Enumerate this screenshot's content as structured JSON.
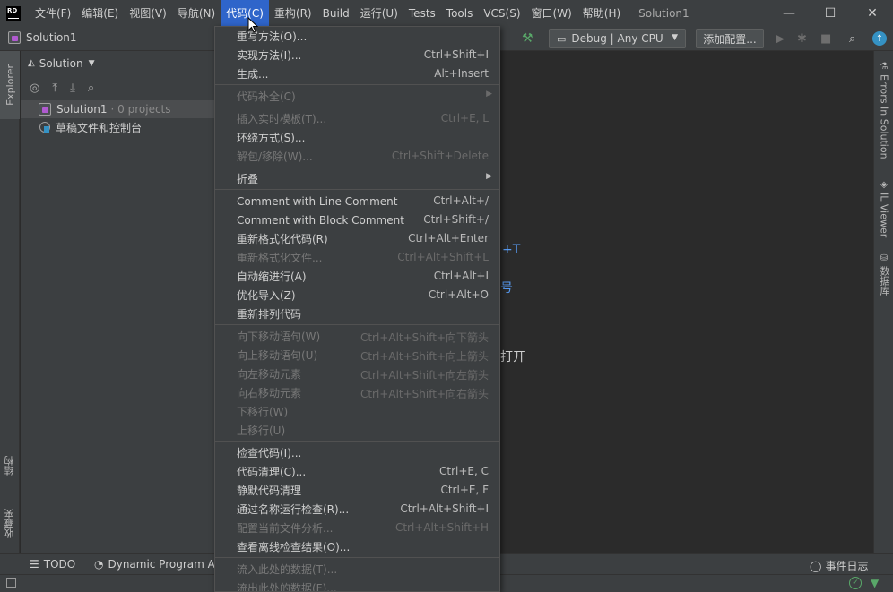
{
  "menubar": {
    "logo": "RD",
    "items": [
      "文件(F)",
      "编辑(E)",
      "视图(V)",
      "导航(N)",
      "代码(C)",
      "重构(R)",
      "Build",
      "运行(U)",
      "Tests",
      "Tools",
      "VCS(S)",
      "窗口(W)",
      "帮助(H)"
    ],
    "active_index": 4,
    "window_title": "Solution1"
  },
  "window_controls": {
    "minimize": "—",
    "maximize": "☐",
    "close": "✕"
  },
  "toolbar": {
    "breadcrumb": "Solution1",
    "config": "Debug | Any CPU",
    "add_config": "添加配置..."
  },
  "left_strip": {
    "explorer_tab": "Explorer",
    "structure_tab": "结构",
    "favorites_tab": "收藏夹"
  },
  "explorer": {
    "header": "Solution",
    "tree": [
      {
        "label": "Solution1",
        "meta": "· 0 projects"
      },
      {
        "label": "草稿文件和控制台",
        "meta": ""
      }
    ]
  },
  "editor_hints": [
    "+T",
    "号",
    "打开"
  ],
  "right_strip": {
    "tabs": [
      "Errors In Solution",
      "IL Viewer",
      "数据库"
    ]
  },
  "bottom_tools": {
    "todo": "TODO",
    "dpa": "Dynamic Program Ana",
    "event_log": "事件日志"
  },
  "code_menu": {
    "groups": [
      [
        {
          "label": "重写方法(O)...",
          "shortcut": "",
          "disabled": false
        },
        {
          "label": "实现方法(I)...",
          "shortcut": "Ctrl+Shift+I",
          "disabled": false
        },
        {
          "label": "生成...",
          "shortcut": "Alt+Insert",
          "disabled": false
        }
      ],
      [
        {
          "label": "代码补全(C)",
          "shortcut": "",
          "disabled": true,
          "submenu": true
        }
      ],
      [
        {
          "label": "插入实时模板(T)...",
          "shortcut": "Ctrl+E, L",
          "disabled": true
        },
        {
          "label": "环绕方式(S)...",
          "shortcut": "",
          "disabled": false
        },
        {
          "label": "解包/移除(W)...",
          "shortcut": "Ctrl+Shift+Delete",
          "disabled": true
        }
      ],
      [
        {
          "label": "折叠",
          "shortcut": "",
          "disabled": false,
          "submenu": true
        }
      ],
      [
        {
          "label": "Comment with Line Comment",
          "shortcut": "Ctrl+Alt+/",
          "disabled": false
        },
        {
          "label": "Comment with Block Comment",
          "shortcut": "Ctrl+Shift+/",
          "disabled": false
        },
        {
          "label": "重新格式化代码(R)",
          "shortcut": "Ctrl+Alt+Enter",
          "disabled": false
        },
        {
          "label": "重新格式化文件...",
          "shortcut": "Ctrl+Alt+Shift+L",
          "disabled": true
        },
        {
          "label": "自动缩进行(A)",
          "shortcut": "Ctrl+Alt+I",
          "disabled": false
        },
        {
          "label": "优化导入(Z)",
          "shortcut": "Ctrl+Alt+O",
          "disabled": false
        },
        {
          "label": "重新排列代码",
          "shortcut": "",
          "disabled": false
        }
      ],
      [
        {
          "label": "向下移动语句(W)",
          "shortcut": "Ctrl+Alt+Shift+向下箭头",
          "disabled": true
        },
        {
          "label": "向上移动语句(U)",
          "shortcut": "Ctrl+Alt+Shift+向上箭头",
          "disabled": true
        },
        {
          "label": "向左移动元素",
          "shortcut": "Ctrl+Alt+Shift+向左箭头",
          "disabled": true
        },
        {
          "label": "向右移动元素",
          "shortcut": "Ctrl+Alt+Shift+向右箭头",
          "disabled": true
        },
        {
          "label": "下移行(W)",
          "shortcut": "",
          "disabled": true
        },
        {
          "label": "上移行(U)",
          "shortcut": "",
          "disabled": true
        }
      ],
      [
        {
          "label": "检查代码(I)...",
          "shortcut": "",
          "disabled": false
        },
        {
          "label": "代码清理(C)...",
          "shortcut": "Ctrl+E, C",
          "disabled": false
        },
        {
          "label": "静默代码清理",
          "shortcut": "Ctrl+E, F",
          "disabled": false
        },
        {
          "label": "通过名称运行检查(R)...",
          "shortcut": "Ctrl+Alt+Shift+I",
          "disabled": false
        },
        {
          "label": "配置当前文件分析...",
          "shortcut": "Ctrl+Alt+Shift+H",
          "disabled": true
        },
        {
          "label": "查看离线检查结果(O)...",
          "shortcut": "",
          "disabled": false
        }
      ],
      [
        {
          "label": "流入此处的数据(T)...",
          "shortcut": "",
          "disabled": true
        },
        {
          "label": "流出此处的数据(F)...",
          "shortcut": "",
          "disabled": true
        }
      ]
    ]
  }
}
